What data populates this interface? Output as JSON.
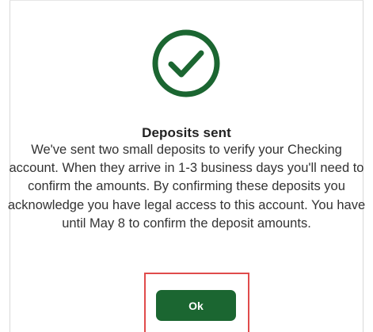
{
  "dialog": {
    "icon": "check-circle-icon",
    "title": "Deposits sent",
    "message": "We've sent two small deposits to verify your Checking account. When they arrive in 1-3 business days you'll need to confirm the amounts. By confirming these deposits you acknowledge you have legal access to this account. You have until May 8 to confirm the deposit amounts.",
    "ok_label": "Ok"
  },
  "colors": {
    "accent": "#1b6631",
    "highlight": "#e04b4b"
  }
}
